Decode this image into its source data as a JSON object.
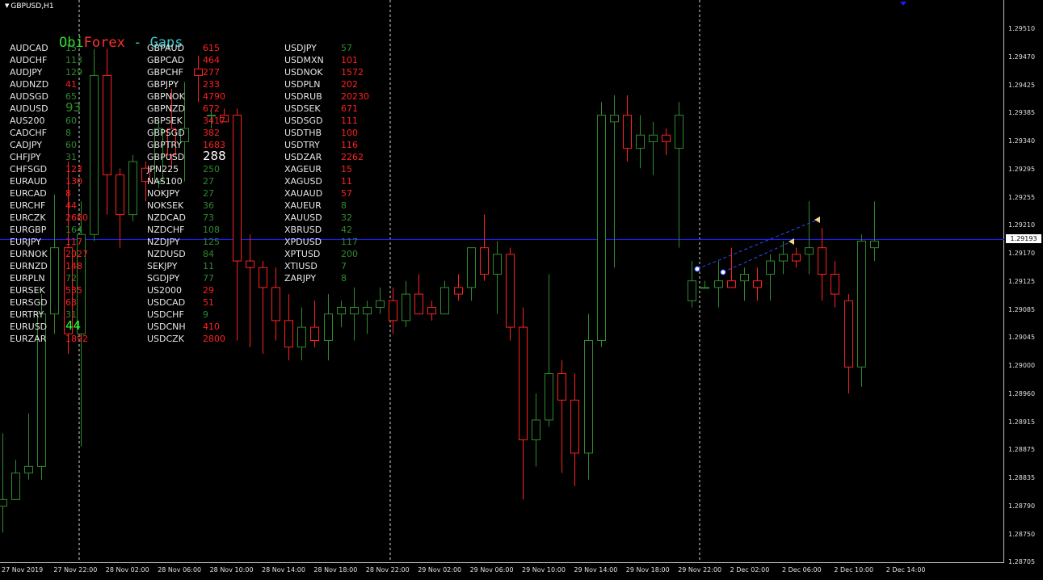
{
  "window": {
    "title": "GBPUSD,H1"
  },
  "logo": {
    "part1": "Obi",
    "part2": "Forex",
    "part3": " - Gaps",
    "colors": [
      "#32dc32",
      "#ff3030",
      "#3cc8c8"
    ]
  },
  "colors": {
    "background": "#000000",
    "bull": "#2e8b2e",
    "bear": "#ff2020",
    "current_price_line": "#1c1cff",
    "grid_separator": "#ffffff",
    "text": "#e6e6e6"
  },
  "gaps": {
    "columns": [
      [
        {
          "symbol": "AUDCAD",
          "value": "15",
          "color": "green"
        },
        {
          "symbol": "AUDCHF",
          "value": "113",
          "color": "green"
        },
        {
          "symbol": "AUDJPY",
          "value": "129",
          "color": "green"
        },
        {
          "symbol": "AUDNZD",
          "value": "41",
          "color": "red"
        },
        {
          "symbol": "AUDSGD",
          "value": "65",
          "color": "green"
        },
        {
          "symbol": "AUDUSD",
          "value": "93",
          "color": "green",
          "big": true
        },
        {
          "symbol": "AUS200",
          "value": "60",
          "color": "green"
        },
        {
          "symbol": "CADCHF",
          "value": "8",
          "color": "green"
        },
        {
          "symbol": "CADJPY",
          "value": "60",
          "color": "green"
        },
        {
          "symbol": "CHFJPY",
          "value": "31",
          "color": "green"
        },
        {
          "symbol": "CHFSGD",
          "value": "123",
          "color": "red"
        },
        {
          "symbol": "EURAUD",
          "value": "130",
          "color": "red"
        },
        {
          "symbol": "EURCAD",
          "value": "8",
          "color": "red"
        },
        {
          "symbol": "EURCHF",
          "value": "44",
          "color": "red"
        },
        {
          "symbol": "EURCZK",
          "value": "2680",
          "color": "red"
        },
        {
          "symbol": "EURGBP",
          "value": "164",
          "color": "green"
        },
        {
          "symbol": "EURJPY",
          "value": "117",
          "color": "red"
        },
        {
          "symbol": "EURNOK",
          "value": "2027",
          "color": "red"
        },
        {
          "symbol": "EURNZD",
          "value": "148",
          "color": "red"
        },
        {
          "symbol": "EURPLN",
          "value": "72",
          "color": "green"
        },
        {
          "symbol": "EURSEK",
          "value": "535",
          "color": "red"
        },
        {
          "symbol": "EURSGD",
          "value": "63",
          "color": "red"
        },
        {
          "symbol": "EURTRY",
          "value": "31",
          "color": "green"
        },
        {
          "symbol": "EURUSD",
          "value": "44",
          "color": "lime",
          "big": true
        },
        {
          "symbol": "EURZAR",
          "value": "1892",
          "color": "red"
        }
      ],
      [
        {
          "symbol": "GBPAUD",
          "value": "615",
          "color": "red"
        },
        {
          "symbol": "GBPCAD",
          "value": "464",
          "color": "red"
        },
        {
          "symbol": "GBPCHF",
          "value": "277",
          "color": "red"
        },
        {
          "symbol": "GBPJPY",
          "value": "233",
          "color": "red"
        },
        {
          "symbol": "GBPNOK",
          "value": "4790",
          "color": "red"
        },
        {
          "symbol": "GBPNZD",
          "value": "672",
          "color": "red"
        },
        {
          "symbol": "GBPSEK",
          "value": "3417",
          "color": "red"
        },
        {
          "symbol": "GBPSGD",
          "value": "382",
          "color": "red"
        },
        {
          "symbol": "GBPTRY",
          "value": "1683",
          "color": "red"
        },
        {
          "symbol": "GBPUSD",
          "value": "288",
          "color": "white",
          "big": true
        },
        {
          "symbol": "JPN225",
          "value": "250",
          "color": "green"
        },
        {
          "symbol": "NAS100",
          "value": "27",
          "color": "green"
        },
        {
          "symbol": "NOKJPY",
          "value": "27",
          "color": "green"
        },
        {
          "symbol": "NOKSEK",
          "value": "36",
          "color": "green"
        },
        {
          "symbol": "NZDCAD",
          "value": "73",
          "color": "green"
        },
        {
          "symbol": "NZDCHF",
          "value": "108",
          "color": "green"
        },
        {
          "symbol": "NZDJPY",
          "value": "125",
          "color": "green"
        },
        {
          "symbol": "NZDUSD",
          "value": "84",
          "color": "green"
        },
        {
          "symbol": "SEKJPY",
          "value": "11",
          "color": "green"
        },
        {
          "symbol": "SGDJPY",
          "value": "77",
          "color": "green"
        },
        {
          "symbol": "US2000",
          "value": "29",
          "color": "red"
        },
        {
          "symbol": "USDCAD",
          "value": "51",
          "color": "red"
        },
        {
          "symbol": "USDCHF",
          "value": "9",
          "color": "green"
        },
        {
          "symbol": "USDCNH",
          "value": "410",
          "color": "red"
        },
        {
          "symbol": "USDCZK",
          "value": "2800",
          "color": "red"
        }
      ],
      [
        {
          "symbol": "USDJPY",
          "value": "57",
          "color": "green"
        },
        {
          "symbol": "USDMXN",
          "value": "101",
          "color": "red"
        },
        {
          "symbol": "USDNOK",
          "value": "1572",
          "color": "red"
        },
        {
          "symbol": "USDPLN",
          "value": "202",
          "color": "red"
        },
        {
          "symbol": "USDRUB",
          "value": "20230",
          "color": "red"
        },
        {
          "symbol": "USDSEK",
          "value": "671",
          "color": "red"
        },
        {
          "symbol": "USDSGD",
          "value": "111",
          "color": "red"
        },
        {
          "symbol": "USDTHB",
          "value": "100",
          "color": "red"
        },
        {
          "symbol": "USDTRY",
          "value": "116",
          "color": "red"
        },
        {
          "symbol": "USDZAR",
          "value": "2262",
          "color": "red"
        },
        {
          "symbol": "XAGEUR",
          "value": "15",
          "color": "red"
        },
        {
          "symbol": "XAGUSD",
          "value": "11",
          "color": "red"
        },
        {
          "symbol": "XAUAUD",
          "value": "57",
          "color": "red"
        },
        {
          "symbol": "XAUEUR",
          "value": "8",
          "color": "green"
        },
        {
          "symbol": "XAUUSD",
          "value": "32",
          "color": "green"
        },
        {
          "symbol": "XBRUSD",
          "value": "42",
          "color": "green"
        },
        {
          "symbol": "XPDUSD",
          "value": "117",
          "color": "green"
        },
        {
          "symbol": "XPTUSD",
          "value": "200",
          "color": "green"
        },
        {
          "symbol": "XTIUSD",
          "value": "7",
          "color": "green"
        },
        {
          "symbol": "ZARJPY",
          "value": "8",
          "color": "green"
        }
      ]
    ]
  },
  "price_axis": {
    "labels": [
      "1.29510",
      "1.29470",
      "1.29425",
      "1.29385",
      "1.29340",
      "1.29295",
      "1.29255",
      "1.29210",
      "1.29170",
      "1.29125",
      "1.29085",
      "1.29045",
      "1.29000",
      "1.28960",
      "1.28915",
      "1.28875",
      "1.28835",
      "1.28790",
      "1.28750",
      "1.28705"
    ],
    "current_price": "1.29193"
  },
  "time_axis": {
    "labels": [
      "27 Nov 2019",
      "27 Nov 22:00",
      "28 Nov 02:00",
      "28 Nov 06:00",
      "28 Nov 10:00",
      "28 Nov 14:00",
      "28 Nov 18:00",
      "28 Nov 22:00",
      "29 Nov 02:00",
      "29 Nov 06:00",
      "29 Nov 10:00",
      "29 Nov 14:00",
      "29 Nov 18:00",
      "29 Nov 22:00",
      "2 Dec 02:00",
      "2 Dec 06:00",
      "2 Dec 10:00",
      "2 Dec 14:00"
    ]
  },
  "chart_data": {
    "type": "candlestick",
    "symbol": "GBPUSD",
    "timeframe": "H1",
    "price_range": [
      1.28705,
      1.2951
    ],
    "current_price": 1.29193,
    "candles": [
      {
        "o": 1.2879,
        "h": 1.289,
        "l": 1.2875,
        "c": 1.288
      },
      {
        "o": 1.288,
        "h": 1.2886,
        "l": 1.288,
        "c": 1.2884
      },
      {
        "o": 1.2884,
        "h": 1.2893,
        "l": 1.2883,
        "c": 1.2885
      },
      {
        "o": 1.2885,
        "h": 1.2911,
        "l": 1.2883,
        "c": 1.2908
      },
      {
        "o": 1.2908,
        "h": 1.2926,
        "l": 1.2905,
        "c": 1.2918
      },
      {
        "o": 1.2918,
        "h": 1.2931,
        "l": 1.2902,
        "c": 1.2905
      },
      {
        "o": 1.2905,
        "h": 1.2925,
        "l": 1.2888,
        "c": 1.292
      },
      {
        "o": 1.292,
        "h": 1.2948,
        "l": 1.2919,
        "c": 1.2944
      },
      {
        "o": 1.2944,
        "h": 1.2948,
        "l": 1.2923,
        "c": 1.2929
      },
      {
        "o": 1.2929,
        "h": 1.293,
        "l": 1.2918,
        "c": 1.2923
      },
      {
        "o": 1.2923,
        "h": 1.2932,
        "l": 1.2922,
        "c": 1.2931
      },
      {
        "o": 1.293,
        "h": 1.2931,
        "l": 1.2925,
        "c": 1.2928
      },
      {
        "o": 1.2928,
        "h": 1.2937,
        "l": 1.2927,
        "c": 1.2936
      },
      {
        "o": 1.2936,
        "h": 1.2942,
        "l": 1.293,
        "c": 1.2932
      },
      {
        "o": 1.2934,
        "h": 1.2943,
        "l": 1.2928,
        "c": 1.2936
      },
      {
        "o": 1.2945,
        "h": 1.2947,
        "l": 1.294,
        "c": 1.2944
      },
      {
        "o": 1.2938,
        "h": 1.2939,
        "l": 1.2936,
        "c": 1.2938
      },
      {
        "o": 1.2938,
        "h": 1.2939,
        "l": 1.2937,
        "c": 1.2937
      },
      {
        "o": 1.2938,
        "h": 1.2939,
        "l": 1.2904,
        "c": 1.2916
      },
      {
        "o": 1.2916,
        "h": 1.292,
        "l": 1.2903,
        "c": 1.2915
      },
      {
        "o": 1.2915,
        "h": 1.2916,
        "l": 1.2902,
        "c": 1.2912
      },
      {
        "o": 1.2912,
        "h": 1.2915,
        "l": 1.2904,
        "c": 1.2907
      },
      {
        "o": 1.2907,
        "h": 1.2911,
        "l": 1.2901,
        "c": 1.2903
      },
      {
        "o": 1.2903,
        "h": 1.2909,
        "l": 1.2901,
        "c": 1.2906
      },
      {
        "o": 1.2906,
        "h": 1.291,
        "l": 1.2903,
        "c": 1.2904
      },
      {
        "o": 1.2904,
        "h": 1.2911,
        "l": 1.2901,
        "c": 1.2908
      },
      {
        "o": 1.2908,
        "h": 1.291,
        "l": 1.2906,
        "c": 1.2909
      },
      {
        "o": 1.2908,
        "h": 1.2912,
        "l": 1.2904,
        "c": 1.2909
      },
      {
        "o": 1.2908,
        "h": 1.291,
        "l": 1.2905,
        "c": 1.2909
      },
      {
        "o": 1.2909,
        "h": 1.2912,
        "l": 1.2908,
        "c": 1.291
      },
      {
        "o": 1.291,
        "h": 1.2912,
        "l": 1.2905,
        "c": 1.2907
      },
      {
        "o": 1.2907,
        "h": 1.2913,
        "l": 1.2906,
        "c": 1.2911
      },
      {
        "o": 1.2911,
        "h": 1.2914,
        "l": 1.2908,
        "c": 1.2908
      },
      {
        "o": 1.2909,
        "h": 1.291,
        "l": 1.2907,
        "c": 1.2908
      },
      {
        "o": 1.2908,
        "h": 1.2913,
        "l": 1.2908,
        "c": 1.2912
      },
      {
        "o": 1.2912,
        "h": 1.2914,
        "l": 1.291,
        "c": 1.2911
      },
      {
        "o": 1.2912,
        "h": 1.2918,
        "l": 1.291,
        "c": 1.2918
      },
      {
        "o": 1.2918,
        "h": 1.2923,
        "l": 1.2913,
        "c": 1.2914
      },
      {
        "o": 1.2914,
        "h": 1.2919,
        "l": 1.2908,
        "c": 1.2917
      },
      {
        "o": 1.2917,
        "h": 1.2918,
        "l": 1.2904,
        "c": 1.2906
      },
      {
        "o": 1.2906,
        "h": 1.2909,
        "l": 1.288,
        "c": 1.2889
      },
      {
        "o": 1.2889,
        "h": 1.2896,
        "l": 1.2885,
        "c": 1.2892
      },
      {
        "o": 1.2892,
        "h": 1.2914,
        "l": 1.2891,
        "c": 1.2899
      },
      {
        "o": 1.2899,
        "h": 1.2901,
        "l": 1.2884,
        "c": 1.2895
      },
      {
        "o": 1.2895,
        "h": 1.2899,
        "l": 1.2882,
        "c": 1.2887
      },
      {
        "o": 1.2887,
        "h": 1.2908,
        "l": 1.2883,
        "c": 1.2904
      },
      {
        "o": 1.2904,
        "h": 1.294,
        "l": 1.2903,
        "c": 1.2938
      },
      {
        "o": 1.2937,
        "h": 1.2941,
        "l": 1.2915,
        "c": 1.2938
      },
      {
        "o": 1.2938,
        "h": 1.2941,
        "l": 1.2931,
        "c": 1.2933
      },
      {
        "o": 1.2933,
        "h": 1.2938,
        "l": 1.293,
        "c": 1.2935
      },
      {
        "o": 1.2934,
        "h": 1.2937,
        "l": 1.2929,
        "c": 1.2935
      },
      {
        "o": 1.2935,
        "h": 1.2936,
        "l": 1.2932,
        "c": 1.2934
      },
      {
        "o": 1.2933,
        "h": 1.294,
        "l": 1.2918,
        "c": 1.2938
      },
      {
        "o": 1.291,
        "h": 1.2916,
        "l": 1.2909,
        "c": 1.2913
      },
      {
        "o": 1.2912,
        "h": 1.2913,
        "l": 1.2912,
        "c": 1.2912
      },
      {
        "o": 1.2912,
        "h": 1.2916,
        "l": 1.2909,
        "c": 1.2913
      },
      {
        "o": 1.2913,
        "h": 1.2918,
        "l": 1.2912,
        "c": 1.2912
      },
      {
        "o": 1.2913,
        "h": 1.2915,
        "l": 1.291,
        "c": 1.2914
      },
      {
        "o": 1.2913,
        "h": 1.2915,
        "l": 1.291,
        "c": 1.2912
      },
      {
        "o": 1.2914,
        "h": 1.2917,
        "l": 1.291,
        "c": 1.2916
      },
      {
        "o": 1.2916,
        "h": 1.2919,
        "l": 1.2914,
        "c": 1.2917
      },
      {
        "o": 1.2917,
        "h": 1.2918,
        "l": 1.2915,
        "c": 1.2916
      },
      {
        "o": 1.2917,
        "h": 1.2925,
        "l": 1.2914,
        "c": 1.2918
      },
      {
        "o": 1.2918,
        "h": 1.2921,
        "l": 1.291,
        "c": 1.2914
      },
      {
        "o": 1.2914,
        "h": 1.2916,
        "l": 1.2909,
        "c": 1.2911
      },
      {
        "o": 1.291,
        "h": 1.2911,
        "l": 1.2896,
        "c": 1.29
      },
      {
        "o": 1.29,
        "h": 1.292,
        "l": 1.2897,
        "c": 1.2919
      },
      {
        "o": 1.2918,
        "h": 1.2925,
        "l": 1.2916,
        "c": 1.2919
      }
    ]
  }
}
